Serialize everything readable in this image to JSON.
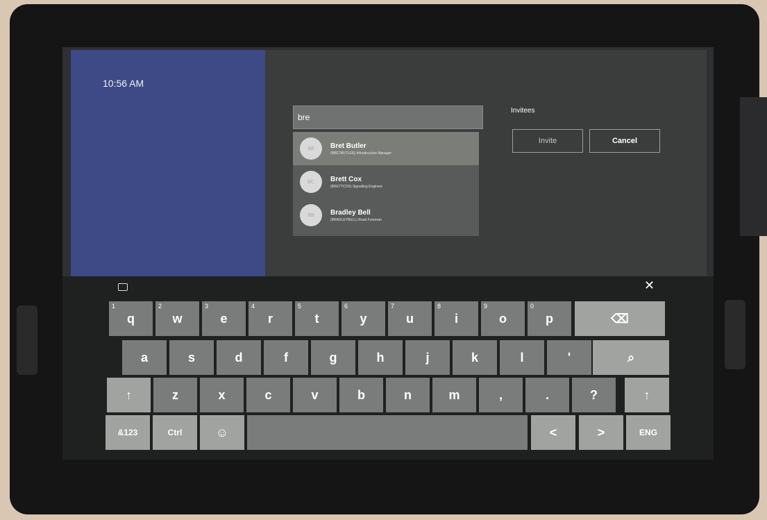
{
  "clock": {
    "time": "10:56 AM"
  },
  "search": {
    "value": "bre"
  },
  "results": [
    {
      "initials": "BB",
      "name": "Bret Butler",
      "subtitle": "(BBETBUTLER) Infrastructure Manager"
    },
    {
      "initials": "BC",
      "name": "Brett Cox",
      "subtitle": "(BRETTCOX) Signalling Engineer"
    },
    {
      "initials": "BB",
      "name": "Bradley Bell",
      "subtitle": "(BRADLEYBELL) Road Foreman"
    }
  ],
  "invitees": {
    "label": "Invitees",
    "invite_label": "Invite",
    "cancel_label": "Cancel"
  },
  "keyboard": {
    "close_glyph": "✕",
    "row1": [
      {
        "k": "q",
        "n": "1"
      },
      {
        "k": "w",
        "n": "2"
      },
      {
        "k": "e",
        "n": "3"
      },
      {
        "k": "r",
        "n": "4"
      },
      {
        "k": "t",
        "n": "5"
      },
      {
        "k": "y",
        "n": "6"
      },
      {
        "k": "u",
        "n": "7"
      },
      {
        "k": "i",
        "n": "8"
      },
      {
        "k": "o",
        "n": "9"
      },
      {
        "k": "p",
        "n": "0"
      }
    ],
    "backspace_glyph": "⌫",
    "row2": [
      "a",
      "s",
      "d",
      "f",
      "g",
      "h",
      "j",
      "k",
      "l",
      "'"
    ],
    "search_glyph": "⌕",
    "row3": [
      "z",
      "x",
      "c",
      "v",
      "b",
      "n",
      "m",
      ",",
      ".",
      "?"
    ],
    "shift_glyph": "↑",
    "symbols_label": "&123",
    "ctrl_label": "Ctrl",
    "emoji_glyph": "☺",
    "left_glyph": "<",
    "right_glyph": ">",
    "lang_label": "ENG"
  }
}
